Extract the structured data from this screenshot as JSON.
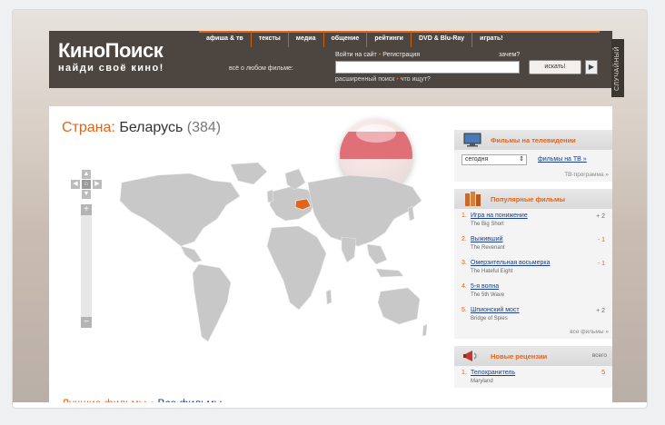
{
  "header": {
    "logo_main": "КиноПоиск",
    "logo_sub": "найди своё кино!",
    "nav": [
      "афиша & тв",
      "тексты",
      "медиа",
      "общение",
      "рейтинги",
      "DVD & Blu-Ray",
      "играть!"
    ],
    "search_label": "всё о любом фильме:",
    "login": "Войти на сайт",
    "register": "Регистрация",
    "why_label": "зачем?",
    "search_input_value": "",
    "search_button": "искать!",
    "search_arrow": "▶",
    "advanced_search": "расширенный поиск",
    "what_to_search": "что ищут?",
    "random_tab": "СЛУЧАЙНЫЙ"
  },
  "country": {
    "label": "Страна:",
    "name": "Беларусь",
    "count": "(384)"
  },
  "map": {
    "highlight_country": "Belarus",
    "highlight_color": "#e0641b",
    "land_color": "#c8c8c8"
  },
  "bottom_links": {
    "best": "Лучшие фильмы",
    "all": "Все фильмы"
  },
  "tv_block": {
    "title": "Фильмы на телевидении",
    "select_value": "сегодня",
    "link": "фильмы на ТВ",
    "link_suffix": "»",
    "more": "ТВ-программа »"
  },
  "popular_block": {
    "title": "Популярные фильмы",
    "films": [
      {
        "num": "1.",
        "title": "Игра на понижение",
        "orig": "The Big Short",
        "delta": "+ 2",
        "trend": "up"
      },
      {
        "num": "2.",
        "title": "Выживший",
        "orig": "The Revenant",
        "delta": "- 1",
        "trend": "down"
      },
      {
        "num": "3.",
        "title": "Омерзительная восьмерка",
        "orig": "The Hateful Eight",
        "delta": "- 1",
        "trend": "down"
      },
      {
        "num": "4.",
        "title": "5-я волна",
        "orig": "The 5th Wave",
        "delta": "",
        "trend": "none"
      },
      {
        "num": "5.",
        "title": "Шпионский мост",
        "orig": "Bridge of Spies",
        "delta": "+ 2",
        "trend": "up"
      }
    ],
    "more": "все фильмы »"
  },
  "reviews_block": {
    "title": "Новые рецензии",
    "total_label": "всего",
    "items": [
      {
        "num": "1.",
        "title": "Телохранитель",
        "orig": "Maryland",
        "count": "5"
      }
    ]
  },
  "colors": {
    "accent": "#e0641b",
    "header_bg": "#4d4640",
    "link": "#1a3e8c"
  }
}
